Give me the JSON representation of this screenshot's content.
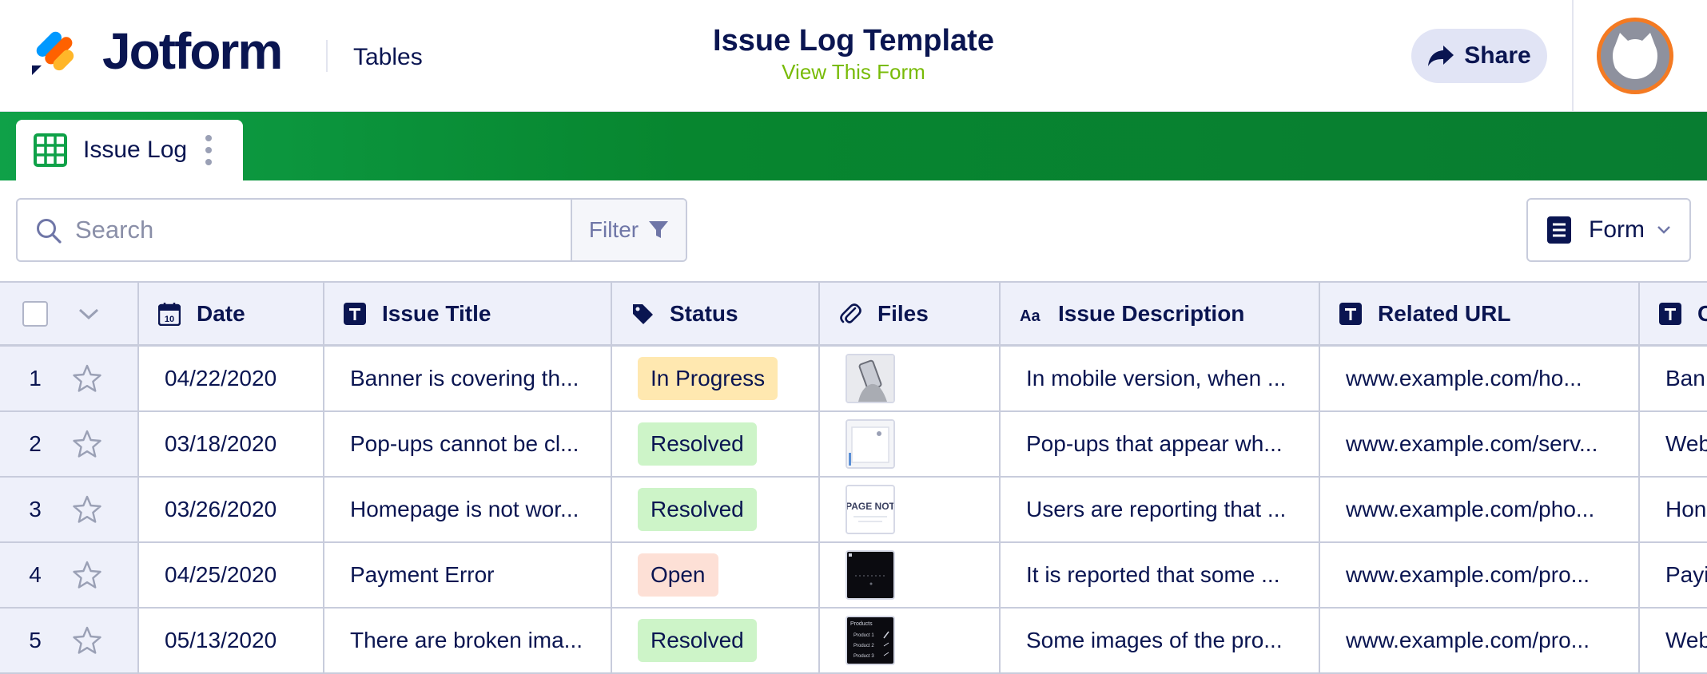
{
  "header": {
    "brand": "Jotform",
    "section": "Tables",
    "title": "Issue Log Template",
    "subtitle_link": "View This Form",
    "share_label": "Share"
  },
  "tabs": [
    {
      "label": "Issue Log",
      "active": true
    }
  ],
  "toolbar": {
    "search_placeholder": "Search",
    "filter_label": "Filter",
    "form_label": "Form"
  },
  "table": {
    "columns": [
      {
        "label": "Date",
        "icon": "calendar-icon"
      },
      {
        "label": "Issue Title",
        "icon": "text-type-icon"
      },
      {
        "label": "Status",
        "icon": "tag-icon"
      },
      {
        "label": "Files",
        "icon": "paperclip-icon"
      },
      {
        "label": "Issue Description",
        "icon": "long-text-icon"
      },
      {
        "label": "Related URL",
        "icon": "text-type-icon"
      },
      {
        "label": "",
        "icon": "text-type-icon"
      }
    ],
    "rows": [
      {
        "num": "1",
        "date": "04/22/2020",
        "title": "Banner is covering th...",
        "status": "In Progress",
        "description": "In mobile version, when ...",
        "url": "www.example.com/ho...",
        "extra": "Ban"
      },
      {
        "num": "2",
        "date": "03/18/2020",
        "title": "Pop-ups cannot be cl...",
        "status": "Resolved",
        "description": "Pop-ups that appear wh...",
        "url": "www.example.com/serv...",
        "extra": "Web"
      },
      {
        "num": "3",
        "date": "03/26/2020",
        "title": "Homepage is not wor...",
        "status": "Resolved",
        "description": "Users are reporting that ...",
        "url": "www.example.com/pho...",
        "extra": "Hon"
      },
      {
        "num": "4",
        "date": "04/25/2020",
        "title": "Payment Error",
        "status": "Open",
        "description": "It is reported that some ...",
        "url": "www.example.com/pro...",
        "extra": "Payi"
      },
      {
        "num": "5",
        "date": "05/13/2020",
        "title": "There are broken ima...",
        "status": "Resolved",
        "description": "Some images of the pro...",
        "url": "www.example.com/pro...",
        "extra": "Web"
      }
    ],
    "thumb_texts": {
      "row3": "PAGE NOT",
      "row5_lines": [
        "Products",
        "Product 1",
        "Product 2",
        "Product 3"
      ]
    }
  },
  "colors": {
    "brand_navy": "#0a1551",
    "tab_bar_green": "#087d31",
    "link_green": "#78bb07",
    "status_in_progress": "#ffe8b0",
    "status_resolved": "#cdf4c8",
    "status_open": "#fde0d6",
    "avatar_ring": "#f47a22"
  }
}
